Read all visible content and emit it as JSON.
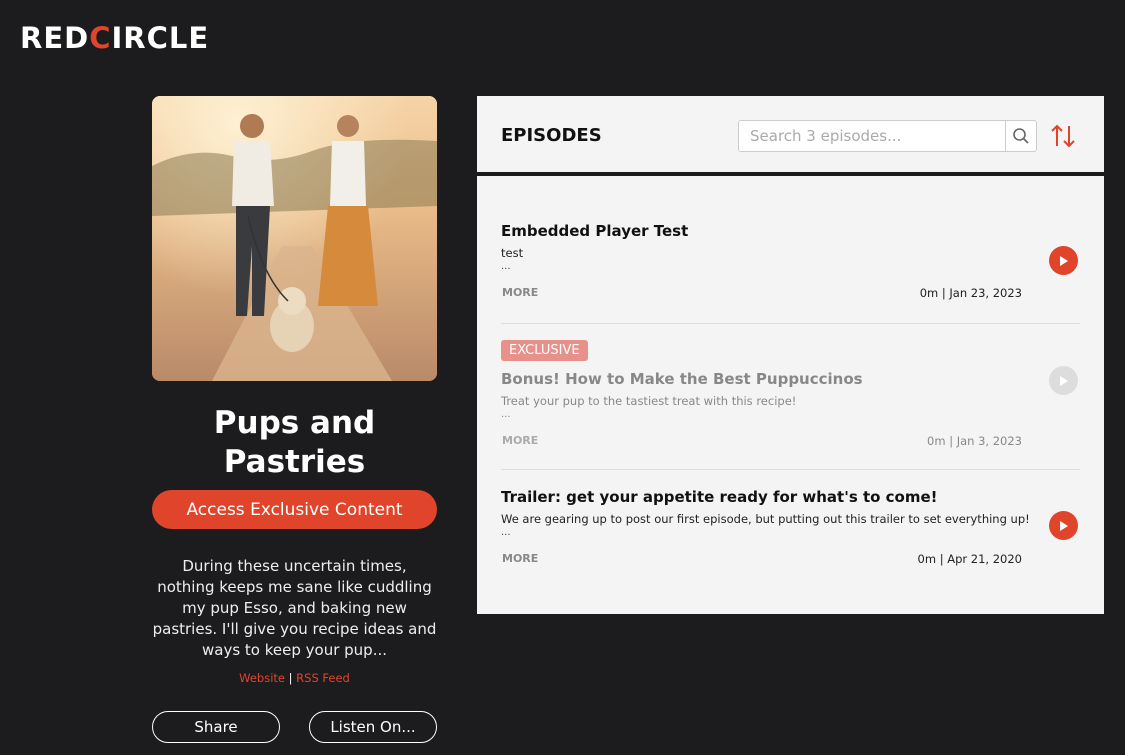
{
  "brand": {
    "logo_left": "RED",
    "logo_o": "C",
    "logo_right": "IRCLE",
    "accent": "#e0442b"
  },
  "show": {
    "title": "Pups and Pastries",
    "exclusive_label": "Access Exclusive Content",
    "description": "During these uncertain times, nothing keeps me sane like cuddling my pup Esso, and baking new pastries. I'll give you recipe ideas and ways to keep your pup...",
    "website_label": "Website",
    "separator": "|",
    "rss_label": "RSS Feed",
    "share_label": "Share",
    "listen_label": "Listen On..."
  },
  "episodes_panel": {
    "title": "EPISODES",
    "search_placeholder": "Search 3 episodes...",
    "items": [
      {
        "title": "Embedded Player Test",
        "description": "test",
        "ellipsis": "...",
        "more": "MORE",
        "meta": "0m | Jan 23, 2023",
        "exclusive": false
      },
      {
        "badge": "EXCLUSIVE",
        "title": "Bonus! How to Make the Best Puppuccinos",
        "description": "Treat your pup to the tastiest treat with this recipe!",
        "ellipsis": "...",
        "more": "MORE",
        "meta": "0m | Jan 3, 2023",
        "exclusive": true
      },
      {
        "title": "Trailer: get your appetite ready for what's to come!",
        "description": "We are gearing up to post our first episode, but putting out this trailer to set everything up!",
        "ellipsis": "...",
        "more": "MORE",
        "meta": "0m | Apr 21, 2020",
        "exclusive": false
      }
    ]
  }
}
